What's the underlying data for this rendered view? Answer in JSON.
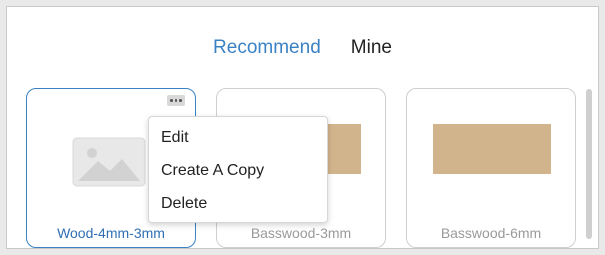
{
  "tabs": [
    {
      "label": "Recommend",
      "active": true
    },
    {
      "label": "Mine",
      "active": false
    }
  ],
  "materials": [
    {
      "name": "Wood-4mm-3mm",
      "selected": true,
      "thumbnail": "placeholder-image-icon"
    },
    {
      "name": "Basswood-3mm",
      "selected": false,
      "thumbnail": "wood-swatch"
    },
    {
      "name": "Basswood-6mm",
      "selected": false,
      "thumbnail": "wood-swatch"
    }
  ],
  "context_menu": {
    "items": [
      "Edit",
      "Create A Copy",
      "Delete"
    ]
  },
  "colors": {
    "accent": "#3b82c4",
    "wood": "#d2b48c"
  }
}
